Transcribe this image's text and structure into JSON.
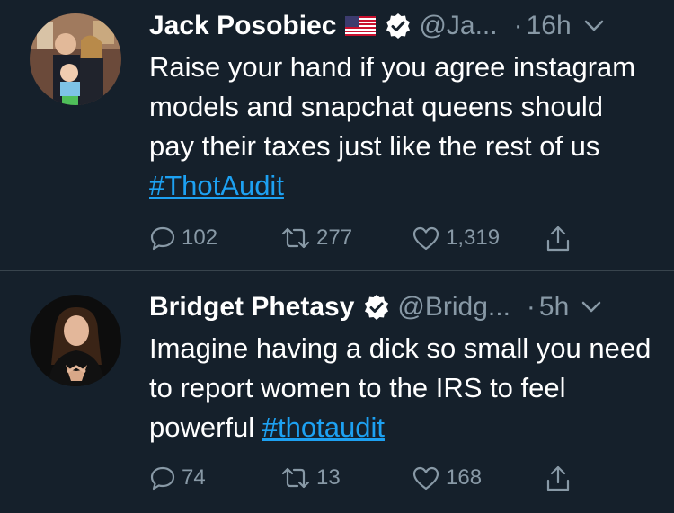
{
  "tweets": [
    {
      "name": "Jack Posobiec",
      "handle": "@Ja...",
      "time": "16h",
      "text": "Raise your hand if you agree instagram models and snapchat queens should pay their taxes just like the rest of us ",
      "hashtag": "#ThotAudit",
      "replies": "102",
      "retweets": "277",
      "likes": "1,319",
      "flag_icon": "us-flag-icon",
      "verified": true
    },
    {
      "name": "Bridget Phetasy",
      "handle": "@Bridg...",
      "time": "5h",
      "text": "Imagine having a dick so small you need to report women to the IRS to feel powerful ",
      "hashtag": "#thotaudit",
      "replies": "74",
      "retweets": "13",
      "likes": "168",
      "verified": true
    }
  ],
  "colors": {
    "background": "#15202b",
    "secondary_text": "#8899a6",
    "link": "#1da1f2",
    "divider": "#38444d"
  }
}
